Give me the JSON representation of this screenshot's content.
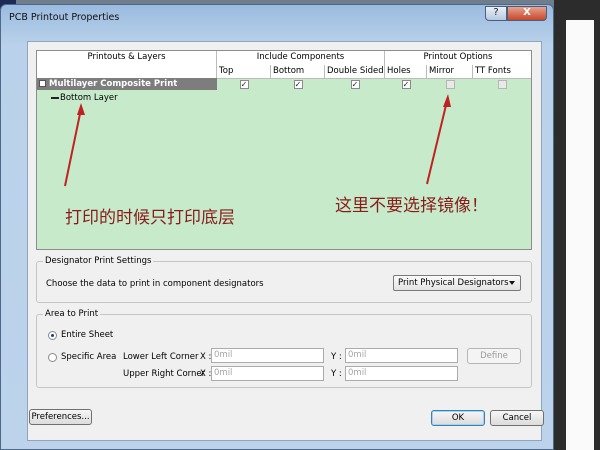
{
  "window": {
    "title": "PCB Printout Properties",
    "help_label": "?",
    "close_label": "X"
  },
  "grid": {
    "groups": [
      "Printouts & Layers",
      "Include Components",
      "Printout Options"
    ],
    "columns": [
      "Top",
      "Bottom",
      "Double Sided",
      "Holes",
      "Mirror",
      "TT Fonts"
    ],
    "printout_name": "Multilayer Composite Print",
    "layer_name": "Bottom Layer",
    "checks": {
      "top": true,
      "bottom": true,
      "double_sided": true,
      "holes": true,
      "mirror": false,
      "tt_fonts": false
    }
  },
  "annotations": {
    "left": "打印的时候只打印底层",
    "right": "这里不要选择镜像！",
    "color": "#8a1b1b"
  },
  "designator": {
    "group_title": "Designator Print Settings",
    "prompt": "Choose the data to print in component designators",
    "selected": "Print Physical Designators"
  },
  "area": {
    "group_title": "Area to Print",
    "entire_sheet": "Entire Sheet",
    "specific_area": "Specific Area",
    "selected": "entire_sheet",
    "lower_left": "Lower Left Corner",
    "upper_right": "Upper Right Corner",
    "x_label": "X :",
    "y_label": "Y :",
    "placeholder": "0mil",
    "define": "Define"
  },
  "footer": {
    "preferences": "Preferences...",
    "ok": "OK",
    "cancel": "Cancel"
  },
  "colors": {
    "grid_bg": "#c7eacb",
    "header_bg": "#ffffff",
    "selected_row": "#7d7d7d"
  }
}
